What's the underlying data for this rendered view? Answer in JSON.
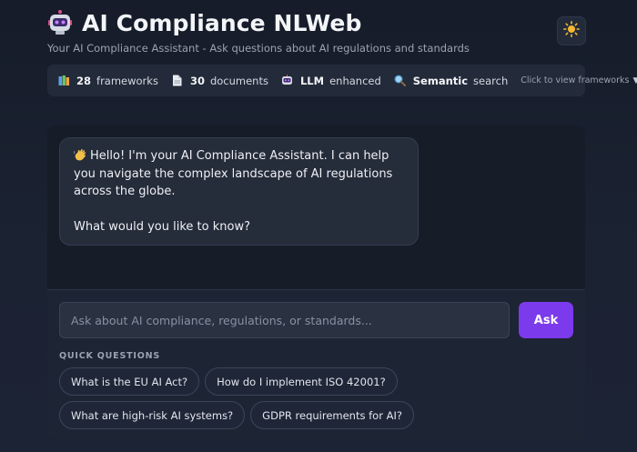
{
  "header": {
    "title": "AI Compliance NLWeb",
    "subtitle": "Your AI Compliance Assistant - Ask questions about AI regulations and standards",
    "logo_icon": "robot-icon",
    "theme_toggle_icon": "sun-icon"
  },
  "stats": {
    "frameworks": {
      "count": "28",
      "label": "frameworks",
      "icon": "books-icon"
    },
    "documents": {
      "count": "30",
      "label": "documents",
      "icon": "document-icon"
    },
    "llm": {
      "count": "LLM",
      "label": "enhanced",
      "icon": "robot-icon"
    },
    "semantic": {
      "count": "Semantic",
      "label": "search",
      "icon": "magnifier-icon"
    },
    "view_frameworks": "Click to view frameworks",
    "caret": "▼"
  },
  "chat": {
    "assistant_message": {
      "line1": "Hello! I'm your AI Compliance Assistant. I can help you navigate the complex landscape of AI regulations across the globe.",
      "line2": "What would you like to know?",
      "icon": "waving-hand-icon"
    }
  },
  "composer": {
    "placeholder": "Ask about AI compliance, regulations, or standards...",
    "value": "",
    "ask_label": "Ask",
    "quick_questions_label": "QUICK QUESTIONS",
    "quick_questions": [
      "What is the EU AI Act?",
      "How do I implement ISO 42001?",
      "What are high-risk AI systems?",
      "GDPR requirements for AI?"
    ]
  },
  "colors": {
    "accent": "#7c3aed",
    "background": "#1a2030",
    "panel": "#161c28",
    "bubble": "#252c3a"
  }
}
